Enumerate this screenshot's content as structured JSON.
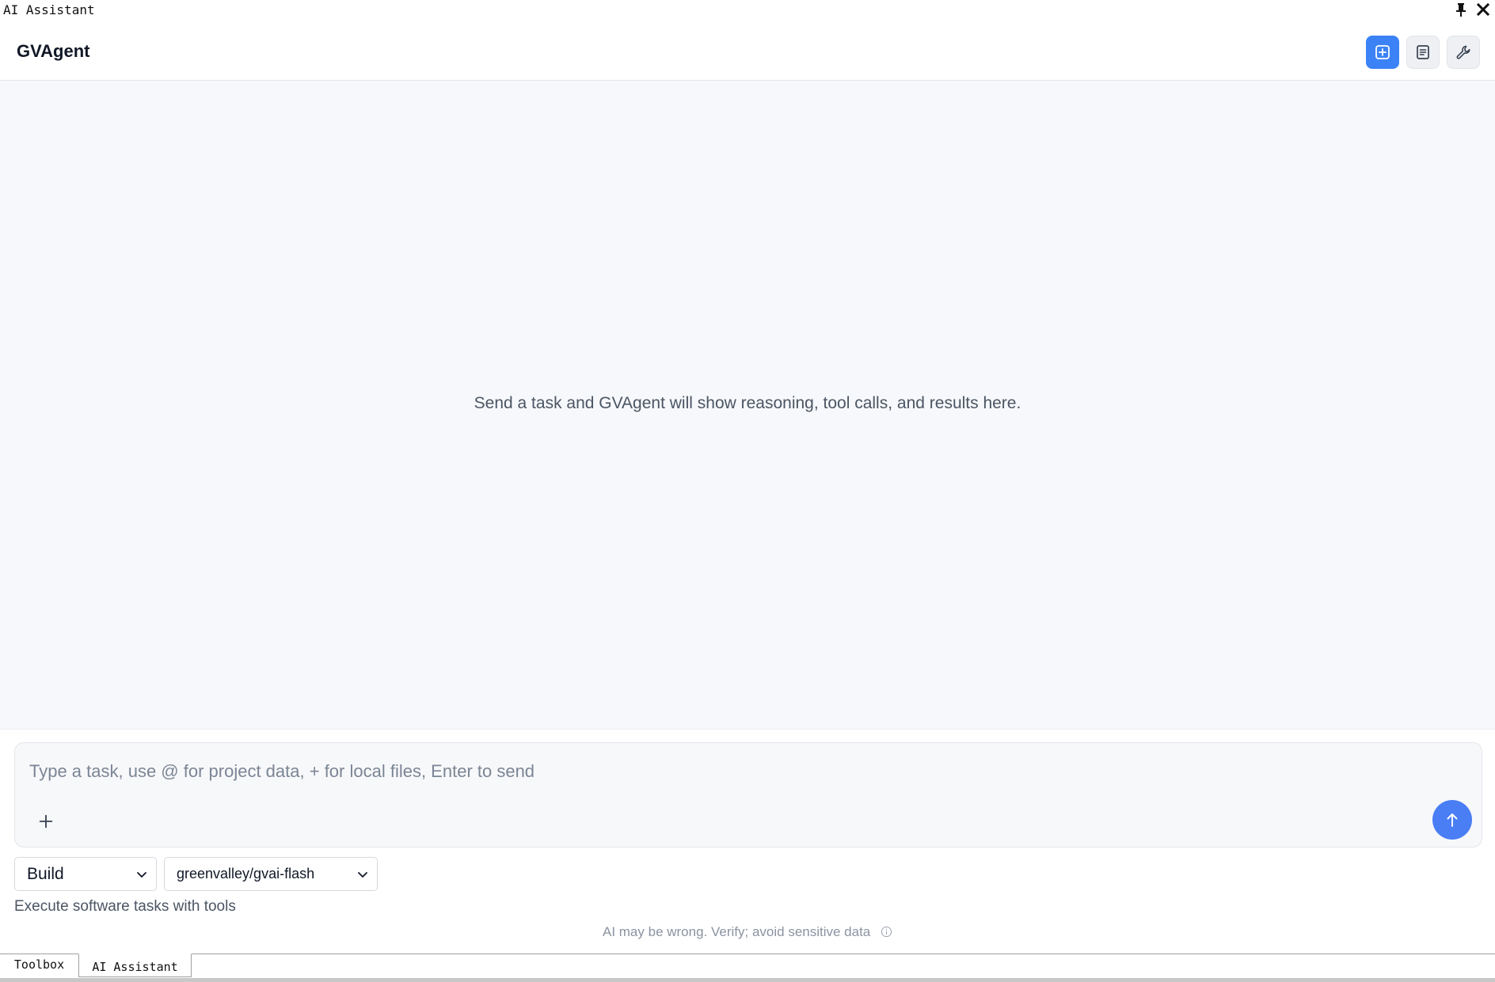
{
  "panel": {
    "title": "AI Assistant",
    "pin_icon": "pin-icon",
    "close_icon": "close-icon"
  },
  "header": {
    "title": "GVAgent",
    "buttons": [
      {
        "icon": "new-chat-icon",
        "active": true
      },
      {
        "icon": "document-icon",
        "active": false
      },
      {
        "icon": "wrench-icon",
        "active": false
      }
    ]
  },
  "chat": {
    "empty_message": "Send a task and GVAgent will show reasoning, tool calls, and results here."
  },
  "composer": {
    "placeholder": "Type a task, use @ for project data, + for local files, Enter to send",
    "value": "",
    "attach_icon": "plus-icon",
    "send_icon": "arrow-up-icon"
  },
  "selectors": {
    "mode": "Build",
    "model": "greenvalley/gvai-flash"
  },
  "mode_description": "Execute software tasks with tools",
  "disclaimer": "AI may be wrong. Verify; avoid sensitive data",
  "tabs": [
    {
      "label": "Toolbox",
      "active": false
    },
    {
      "label": "AI Assistant",
      "active": true
    }
  ],
  "colors": {
    "accent": "#3b82f6",
    "send_button": "#4a7ef5",
    "chat_background": "#f6f8fb"
  }
}
